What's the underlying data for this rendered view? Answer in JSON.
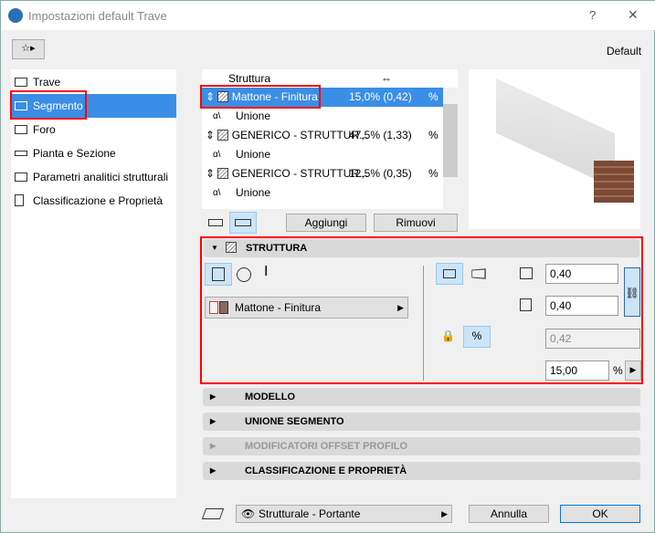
{
  "window": {
    "title": "Impostazioni default Trave",
    "help": "?",
    "close": "✕"
  },
  "header": {
    "preset_label": "Default"
  },
  "sidebar": {
    "items": [
      {
        "label": "Trave"
      },
      {
        "label": "Segmento"
      },
      {
        "label": "Foro"
      },
      {
        "label": "Pianta e Sezione"
      },
      {
        "label": "Parametri analitici strutturali"
      },
      {
        "label": "Classificazione e Proprietà"
      }
    ]
  },
  "skins": {
    "header": "Struttura",
    "rows": [
      {
        "type": "skin",
        "name": "Mattone - Finitura",
        "value": "15,0% (0,42)",
        "selected": true
      },
      {
        "type": "join",
        "name": "Unione"
      },
      {
        "type": "skin",
        "name": "GENERICO - STRUTTUR...",
        "value": "47,5% (1,33)"
      },
      {
        "type": "join",
        "name": "Unione"
      },
      {
        "type": "skin",
        "name": "GENERICO - STRUTTUR...",
        "value": "12,5% (0,35)"
      },
      {
        "type": "join",
        "name": "Unione"
      }
    ],
    "add": "Aggiungi",
    "remove": "Rimuovi"
  },
  "structure": {
    "title": "STRUTTURA",
    "material": "Mattone - Finitura",
    "width": "0,40",
    "height": "0,40",
    "thickness": "0,42",
    "percent": "15,00",
    "percent_unit": "%"
  },
  "sections": [
    "MODELLO",
    "UNIONE SEGMENTO",
    "MODIFICATORI OFFSET PROFILO",
    "CLASSIFICAZIONE E PROPRIETÀ"
  ],
  "footer": {
    "layer": "Strutturale - Portante",
    "cancel": "Annulla",
    "ok": "OK"
  },
  "colors": {
    "accent": "#3a8ee6",
    "highlight": "#ff0000",
    "brick": "#8b5a44"
  }
}
